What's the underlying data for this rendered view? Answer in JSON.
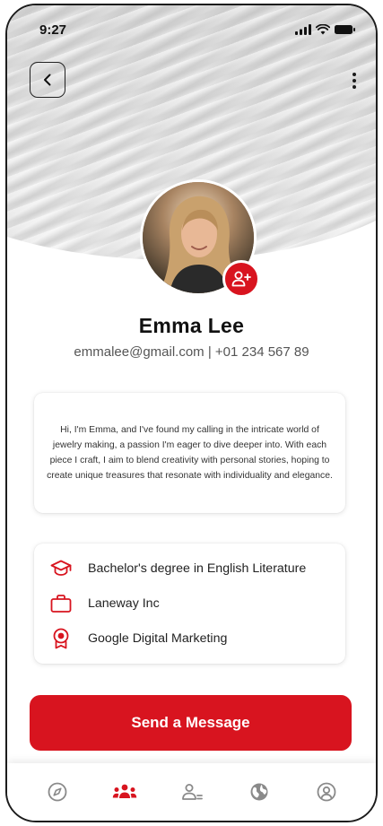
{
  "status_bar": {
    "time": "9:27"
  },
  "profile": {
    "name": "Emma Lee",
    "contact": "emmalee@gmail.com | +01 234 567 89"
  },
  "bio": {
    "text": "Hi, I'm Emma, and I've found my calling in the intricate world of jewelry making, a passion I'm eager to dive deeper into. With each piece I craft, I aim to blend creativity with personal stories, hoping to create unique treasures that resonate with individuality and elegance."
  },
  "info": {
    "items": [
      {
        "icon": "graduation-cap-icon",
        "label": "Bachelor's degree in English Literature"
      },
      {
        "icon": "briefcase-icon",
        "label": "Laneway Inc"
      },
      {
        "icon": "award-icon",
        "label": "Google Digital Marketing"
      }
    ]
  },
  "actions": {
    "send_label": "Send a Message"
  },
  "nav": {
    "items": [
      {
        "icon": "compass-icon",
        "active": false
      },
      {
        "icon": "community-icon",
        "active": true
      },
      {
        "icon": "users-icon",
        "active": false
      },
      {
        "icon": "globe-icon",
        "active": false
      },
      {
        "icon": "profile-icon",
        "active": false
      }
    ]
  },
  "colors": {
    "accent": "#d8141f",
    "inactive_icon": "#8a8a8a",
    "text": "#1a1a1a"
  }
}
